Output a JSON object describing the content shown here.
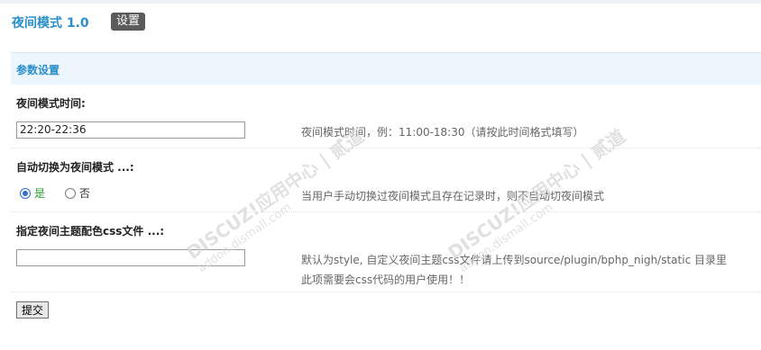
{
  "header": {
    "title": "夜间模式 1.0",
    "badge": "设置"
  },
  "section": {
    "title": "参数设置"
  },
  "fields": {
    "time": {
      "label": "夜间模式时间:",
      "value": "22:20-22:36",
      "hint": "夜间模式时间，例：11:00-18:30（请按此时间格式填写）"
    },
    "auto_switch": {
      "label": "自动切换为夜间模式 ...:",
      "options": [
        "是",
        "否"
      ],
      "selected": "是",
      "hint": "当用户手动切换过夜间模式且存在记录时，则不自动切夜间模式"
    },
    "css_file": {
      "label": "指定夜间主题配色css文件 ...:",
      "value": "",
      "hint_line1": "默认为style, 自定义夜间主题css文件请上传到source/plugin/bphp_nigh/static 目录里",
      "hint_line2": "此项需要会css代码的用户使用！！"
    }
  },
  "submit_label": "提交",
  "watermark": {
    "brand": "DISCUZ!应用中心 | 贰道",
    "domain": "addon.dismall.com"
  }
}
